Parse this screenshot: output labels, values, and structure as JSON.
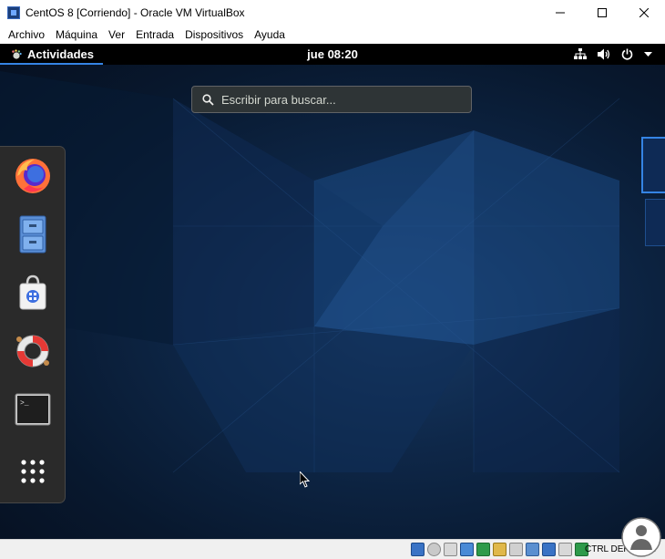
{
  "window": {
    "title": "CentOS 8 [Corriendo] - Oracle VM VirtualBox",
    "icon": "virtualbox-icon",
    "controls": [
      "minimize-icon",
      "maximize-icon",
      "close-icon"
    ]
  },
  "menubar": {
    "items": [
      "Archivo",
      "Máquina",
      "Ver",
      "Entrada",
      "Dispositivos",
      "Ayuda"
    ]
  },
  "topbar": {
    "activities_label": "Actividades",
    "clock": "jue 08:20",
    "tray_icons": [
      "network-icon",
      "volume-icon",
      "power-icon",
      "chevron-down-icon"
    ]
  },
  "search": {
    "placeholder": "Escribir para buscar..."
  },
  "dash": {
    "items": [
      "firefox-icon",
      "files-icon",
      "software-icon",
      "help-icon",
      "terminal-icon",
      "show-applications-icon"
    ]
  },
  "statusbar": {
    "host_key": "CTRL DERECHA"
  },
  "colors": {
    "accent": "#3584e4",
    "topbar": "#000000",
    "dash_bg": "#2a2a2a",
    "desktop": "#0e2748"
  }
}
